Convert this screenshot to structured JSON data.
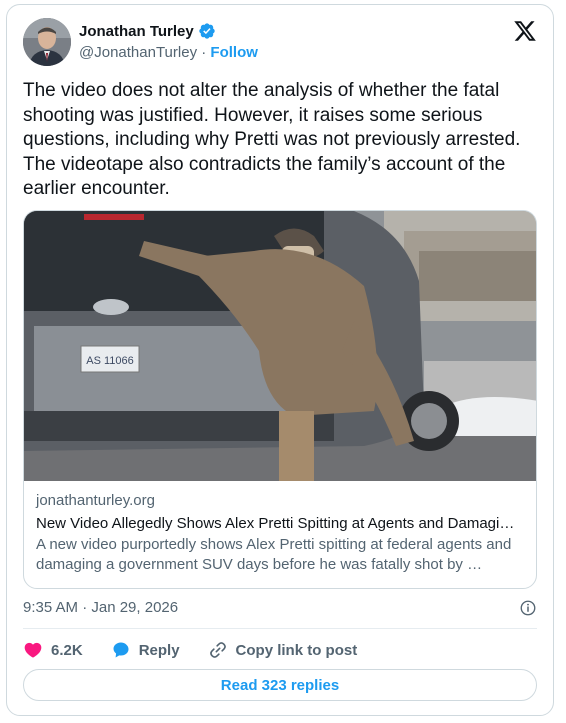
{
  "author": {
    "name": "Jonathan Turley",
    "handle": "@JonathanTurley",
    "separator": "·",
    "follow_label": "Follow"
  },
  "tweet": {
    "text": "The video does not alter the analysis of whether the fatal shooting was justified. However, it raises some serious questions, including why Pretti was not previously arrested. The videotape also contradicts the family’s account of the earlier encounter.",
    "timestamp": "9:35 AM · Jan 29, 2026"
  },
  "link_card": {
    "domain": "jonathanturley.org",
    "title": "New Video Allegedly Shows Alex Pretti Spitting at Agents and Damagi…",
    "description": "A new video purportedly shows Alex Pretti spitting at federal agents and damaging a government SUV days before he was fatally shot by …",
    "plate_text": "AS 11066"
  },
  "actions": {
    "like_count": "6.2K",
    "reply_label": "Reply",
    "copy_label": "Copy link to post"
  },
  "read_replies_label": "Read 323 replies",
  "colors": {
    "accent": "#1d9bf0",
    "like": "#f91880",
    "text": "#0f1419",
    "secondary": "#536471"
  },
  "icons": [
    "verified-badge-icon",
    "x-logo-icon",
    "info-icon",
    "heart-icon",
    "reply-bubble-icon",
    "link-icon"
  ]
}
